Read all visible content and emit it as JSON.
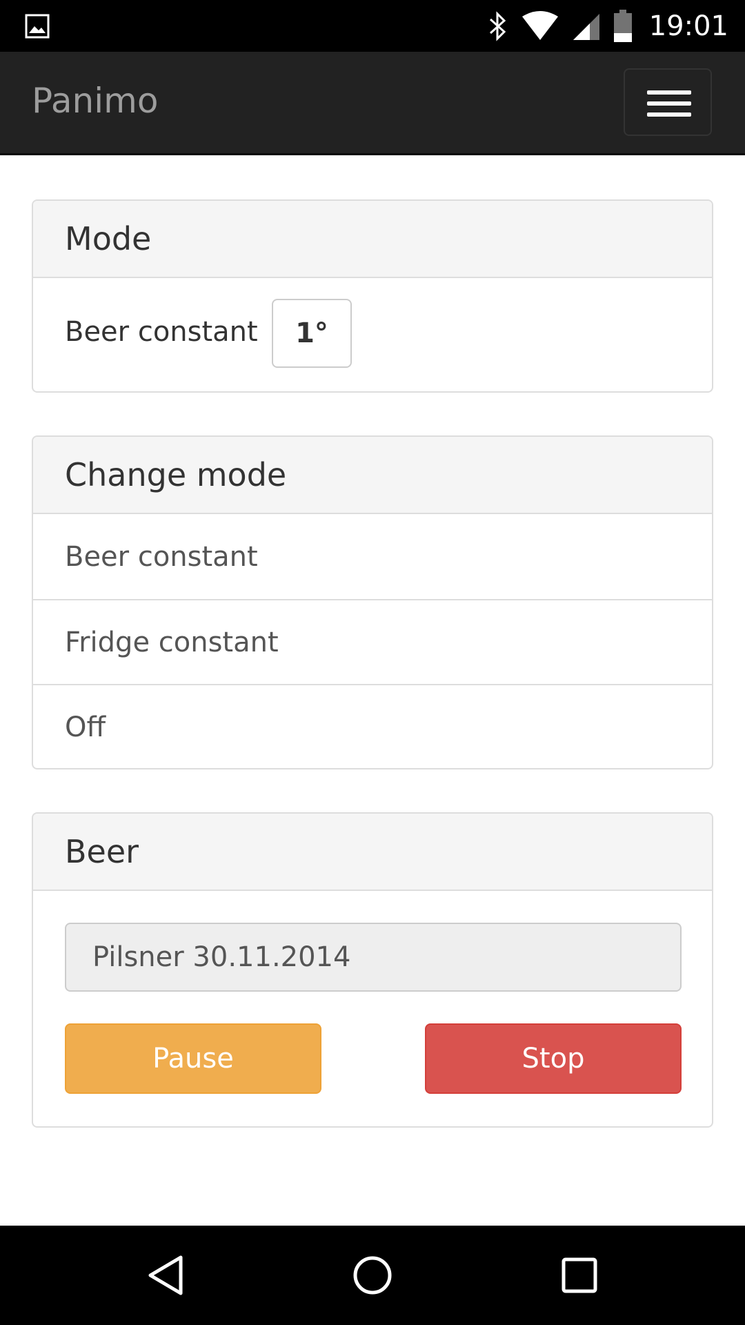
{
  "status_bar": {
    "time": "19:01",
    "icons": [
      "gallery-icon",
      "bluetooth-icon",
      "wifi-icon",
      "signal-icon",
      "battery-icon"
    ]
  },
  "navbar": {
    "brand": "Panimo",
    "menu_icon": "hamburger-menu-icon"
  },
  "mode_panel": {
    "heading": "Mode",
    "current_mode": "Beer constant",
    "temperature": "1°"
  },
  "change_mode_panel": {
    "heading": "Change mode",
    "options": [
      "Beer constant",
      "Fridge constant",
      "Off"
    ]
  },
  "beer_panel": {
    "heading": "Beer",
    "beer_value": "Pilsner 30.11.2014",
    "pause_label": "Pause",
    "stop_label": "Stop"
  },
  "colors": {
    "navbar_bg": "#222222",
    "brand_text": "#9d9d9d",
    "warning": "#f0ad4e",
    "danger": "#d9534f"
  },
  "system_nav": [
    "back-icon",
    "home-icon",
    "recents-icon"
  ]
}
